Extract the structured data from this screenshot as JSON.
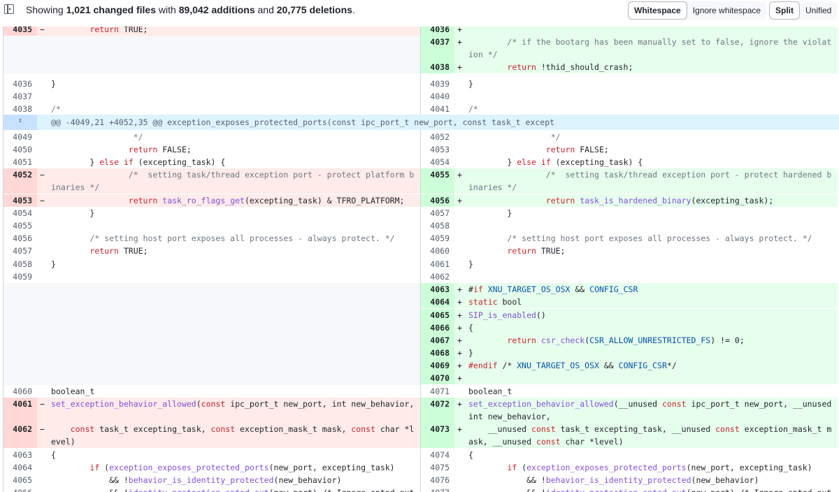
{
  "summary": {
    "prefix": "Showing ",
    "changed": "1,021 changed files",
    "with": " with ",
    "additions": "89,042 additions",
    "and": " and ",
    "deletions": "20,775 deletions",
    "suffix": "."
  },
  "whitespace_toggle": {
    "whitespace": "Whitespace",
    "ignore": "Ignore whitespace"
  },
  "view_toggle": {
    "split": "Split",
    "unified": "Unified"
  },
  "hunk_header": "@@ -4049,21 +4052,35 @@ exception_exposes_protected_ports(const ipc_port_t new_port, const task_t except",
  "left": [
    {
      "n": "4035",
      "s": "−",
      "t": "        return TRUE;"
    },
    {
      "n": "4036",
      "s": "",
      "t": "}"
    },
    {
      "n": "4037",
      "s": "",
      "t": ""
    },
    {
      "n": "4038",
      "s": "",
      "t": "/*"
    },
    {
      "n": "4049",
      "s": "",
      "t": "                 */"
    },
    {
      "n": "4050",
      "s": "",
      "t": "                return FALSE;"
    },
    {
      "n": "4051",
      "s": "",
      "t": "        } else if (excepting_task) {"
    },
    {
      "n": "4052",
      "s": "−",
      "t": "                /*  setting task/thread exception port - protect platform binaries */"
    },
    {
      "n": "4053",
      "s": "−",
      "t": "                return task_ro_flags_get(excepting_task) & TFRO_PLATFORM;"
    },
    {
      "n": "4054",
      "s": "",
      "t": "        }"
    },
    {
      "n": "4055",
      "s": "",
      "t": ""
    },
    {
      "n": "4056",
      "s": "",
      "t": "        /* setting host port exposes all processes - always protect. */"
    },
    {
      "n": "4057",
      "s": "",
      "t": "        return TRUE;"
    },
    {
      "n": "4058",
      "s": "",
      "t": "}"
    },
    {
      "n": "4059",
      "s": "",
      "t": ""
    },
    {
      "n": "4060",
      "s": "",
      "t": "boolean_t"
    },
    {
      "n": "4061",
      "s": "−",
      "t": "set_exception_behavior_allowed(const ipc_port_t new_port, int new_behavior,"
    },
    {
      "n": "4062",
      "s": "−",
      "t": "    const task_t excepting_task, const exception_mask_t mask, const char *level)"
    },
    {
      "n": "4063",
      "s": "",
      "t": "{"
    },
    {
      "n": "4064",
      "s": "",
      "t": "        if (exception_exposes_protected_ports(new_port, excepting_task)"
    },
    {
      "n": "4065",
      "s": "",
      "t": "            && !behavior_is_identity_protected(new_behavior)"
    },
    {
      "n": "4066",
      "s": "",
      "t": "            && !identity_protection_opted_out(new_port) /* Ignore opted out */"
    }
  ],
  "right": [
    {
      "n": "4036",
      "s": "+",
      "t": ""
    },
    {
      "n": "4037",
      "s": "+",
      "t": "        /* if the bootarg has been manually set to false, ignore the violation */"
    },
    {
      "n": "4038",
      "s": "+",
      "t": "        return !thid_should_crash;"
    },
    {
      "n": "4039",
      "s": "",
      "t": "}"
    },
    {
      "n": "4040",
      "s": "",
      "t": ""
    },
    {
      "n": "4041",
      "s": "",
      "t": "/*"
    },
    {
      "n": "4052",
      "s": "",
      "t": "                 */"
    },
    {
      "n": "4053",
      "s": "",
      "t": "                return FALSE;"
    },
    {
      "n": "4054",
      "s": "",
      "t": "        } else if (excepting_task) {"
    },
    {
      "n": "4055",
      "s": "+",
      "t": "                /*  setting task/thread exception port - protect hardened binaries */"
    },
    {
      "n": "4056",
      "s": "+",
      "t": "                return task_is_hardened_binary(excepting_task);"
    },
    {
      "n": "4057",
      "s": "",
      "t": "        }"
    },
    {
      "n": "4058",
      "s": "",
      "t": ""
    },
    {
      "n": "4059",
      "s": "",
      "t": "        /* setting host port exposes all processes - always protect. */"
    },
    {
      "n": "4060",
      "s": "",
      "t": "        return TRUE;"
    },
    {
      "n": "4061",
      "s": "",
      "t": "}"
    },
    {
      "n": "4062",
      "s": "",
      "t": ""
    },
    {
      "n": "4063",
      "s": "+",
      "t": "#if XNU_TARGET_OS_OSX && CONFIG_CSR"
    },
    {
      "n": "4064",
      "s": "+",
      "t": "static bool"
    },
    {
      "n": "4065",
      "s": "+",
      "t": "SIP_is_enabled()"
    },
    {
      "n": "4066",
      "s": "+",
      "t": "{"
    },
    {
      "n": "4067",
      "s": "+",
      "t": "        return csr_check(CSR_ALLOW_UNRESTRICTED_FS) != 0;"
    },
    {
      "n": "4068",
      "s": "+",
      "t": "}"
    },
    {
      "n": "4069",
      "s": "+",
      "t": "#endif /* XNU_TARGET_OS_OSX && CONFIG_CSR*/"
    },
    {
      "n": "4070",
      "s": "+",
      "t": ""
    },
    {
      "n": "4071",
      "s": "",
      "t": "boolean_t"
    },
    {
      "n": "4072",
      "s": "+",
      "t": "set_exception_behavior_allowed(__unused const ipc_port_t new_port, __unused int new_behavior,"
    },
    {
      "n": "4073",
      "s": "+",
      "t": "    __unused const task_t excepting_task, __unused const exception_mask_t mask, __unused const char *level)"
    },
    {
      "n": "4074",
      "s": "",
      "t": "{"
    },
    {
      "n": "4075",
      "s": "",
      "t": "        if (exception_exposes_protected_ports(new_port, excepting_task)"
    },
    {
      "n": "4076",
      "s": "",
      "t": "            && !behavior_is_identity_protected(new_behavior)"
    },
    {
      "n": "4077",
      "s": "",
      "t": "            && !identity_protection_opted_out(new_port) /* Ignore opted out */"
    }
  ]
}
